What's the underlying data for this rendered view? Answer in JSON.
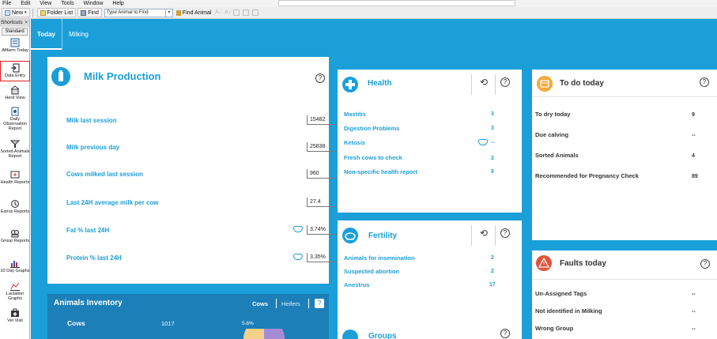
{
  "menu": [
    "File",
    "Edit",
    "View",
    "Tools",
    "Window",
    "Help"
  ],
  "toolbar": {
    "new_label": "New",
    "folder_list_label": "Folder List",
    "find_label": "Find",
    "find_placeholder": "Type Animal to Find",
    "find_animal_label": "Find Animal"
  },
  "shortcuts": {
    "title": "Shortcuts",
    "close": "×",
    "group": "Standard",
    "items": [
      {
        "label": "Afifarm Today",
        "icon": "afifarm-today-icon"
      },
      {
        "label": "Data Entry",
        "icon": "data-entry-icon"
      },
      {
        "label": "Herd View",
        "icon": "herd-view-icon"
      },
      {
        "label": "Daily Observation Report",
        "icon": "daily-observation-icon"
      },
      {
        "label": "Sorted Animals Report",
        "icon": "sorted-animals-icon"
      },
      {
        "label": "Health Reports",
        "icon": "health-reports-icon"
      },
      {
        "label": "Estrus Reports",
        "icon": "estrus-reports-icon"
      },
      {
        "label": "Group Reports",
        "icon": "group-reports-icon"
      },
      {
        "label": "10 Day Graphs",
        "icon": "graphs-icon"
      },
      {
        "label": "Lactation Graphs",
        "icon": "lactation-graphs-icon"
      },
      {
        "label": "Vet Visit",
        "icon": "vet-visit-icon"
      }
    ]
  },
  "tabs": [
    "Today",
    "Milking"
  ],
  "milk_production": {
    "title": "Milk Production",
    "rows": [
      {
        "label": "Milk last session",
        "value": "15482"
      },
      {
        "label": "Milk previous day",
        "value": "25838"
      },
      {
        "label": "Cows milked last session",
        "value": "960"
      },
      {
        "label": "Last 24H average milk per cow",
        "value": "27.4"
      },
      {
        "label": "Fat % last 24H",
        "value": "3.74%"
      },
      {
        "label": "Protein % last 24H",
        "value": "3.35%"
      }
    ]
  },
  "inventory": {
    "title": "Animals Inventory",
    "toggle_cows": "Cows",
    "toggle_heifers": "Heifers",
    "row_label": "Cows",
    "row_value": "1017",
    "pie_percent": "5.6%"
  },
  "health": {
    "title": "Health",
    "rows": [
      {
        "label": "Mastitis",
        "value": "3"
      },
      {
        "label": "Digestion Problems",
        "value": "3"
      },
      {
        "label": "Ketosis",
        "value": "--"
      },
      {
        "label": "Fresh cows to check",
        "value": "2"
      },
      {
        "label": "Non-specific health report",
        "value": "9"
      }
    ]
  },
  "fertility": {
    "title": "Fertility",
    "rows": [
      {
        "label": "Animals for insemination",
        "value": "2"
      },
      {
        "label": "Suspected abortion",
        "value": "2"
      },
      {
        "label": "Anestrus",
        "value": "17"
      }
    ]
  },
  "groups": {
    "title": "Groups"
  },
  "todo": {
    "title": "To do today",
    "rows": [
      {
        "label": "To dry today",
        "value": "9"
      },
      {
        "label": "Due calving",
        "value": "--"
      },
      {
        "label": "Sorted Animals",
        "value": "4"
      },
      {
        "label": "Recommended for Pregnancy Check",
        "value": "89"
      }
    ]
  },
  "faults": {
    "title": "Faults today",
    "rows": [
      {
        "label": "Un-Assigned Tags",
        "value": "--"
      },
      {
        "label": "Not identified in Milking",
        "value": "--"
      },
      {
        "label": "Wrong Group",
        "value": "--"
      }
    ]
  },
  "help_symbol": "?",
  "colors": {
    "accent": "#1a9fd9",
    "todo_icon": "#f4a93c",
    "fault_icon": "#e0523a",
    "inventory_bg": "#1d7fb8"
  }
}
